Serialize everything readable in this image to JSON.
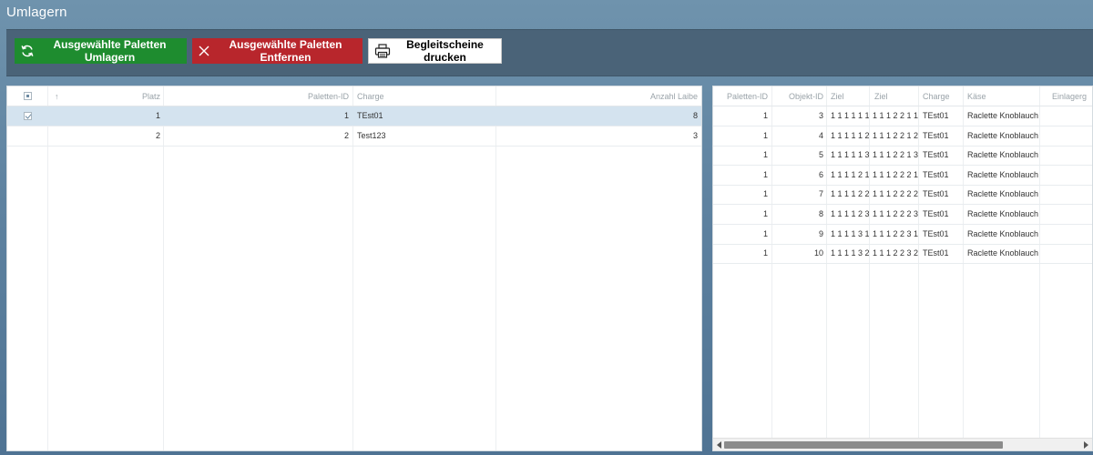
{
  "page": {
    "title": "Umlagern"
  },
  "toolbar": {
    "relocate_label": "Ausgewählte Paletten Umlagern",
    "remove_label": "Ausgewählte Paletten Entfernen",
    "print_label": "Begleitscheine drucken"
  },
  "left_grid": {
    "columns": {
      "sort": "↑",
      "platz": "Platz",
      "paletten_id": "Paletten-ID",
      "charge": "Charge",
      "anzahl": "Anzahl Laibe"
    },
    "rows": [
      {
        "selected": true,
        "platz": "1",
        "paletten_id": "1",
        "charge": "TEst01",
        "anzahl": "8"
      },
      {
        "selected": false,
        "platz": "2",
        "paletten_id": "2",
        "charge": "Test123",
        "anzahl": "3"
      }
    ]
  },
  "right_grid": {
    "columns": {
      "paletten_id": "Paletten-ID",
      "objekt_id": "Objekt-ID",
      "ziel1": "Ziel",
      "ziel2": "Ziel",
      "charge": "Charge",
      "kaese": "Käse",
      "einlager": "Einlagerg"
    },
    "rows": [
      {
        "paletten_id": "1",
        "objekt_id": "3",
        "ziel1": "1 1 1 1 1 1",
        "ziel2": "1 1 1 2 2 1 1",
        "charge": "TEst01",
        "kaese": "Raclette Knoblauch"
      },
      {
        "paletten_id": "1",
        "objekt_id": "4",
        "ziel1": "1 1 1 1 1 2",
        "ziel2": "1 1 1 2 2 1 2",
        "charge": "TEst01",
        "kaese": "Raclette Knoblauch"
      },
      {
        "paletten_id": "1",
        "objekt_id": "5",
        "ziel1": "1 1 1 1 1 3",
        "ziel2": "1 1 1 2 2 1 3",
        "charge": "TEst01",
        "kaese": "Raclette Knoblauch"
      },
      {
        "paletten_id": "1",
        "objekt_id": "6",
        "ziel1": "1 1 1 1 2 1",
        "ziel2": "1 1 1 2 2 2 1",
        "charge": "TEst01",
        "kaese": "Raclette Knoblauch"
      },
      {
        "paletten_id": "1",
        "objekt_id": "7",
        "ziel1": "1 1 1 1 2 2",
        "ziel2": "1 1 1 2 2 2 2",
        "charge": "TEst01",
        "kaese": "Raclette Knoblauch"
      },
      {
        "paletten_id": "1",
        "objekt_id": "8",
        "ziel1": "1 1 1 1 2 3",
        "ziel2": "1 1 1 2 2 2 3",
        "charge": "TEst01",
        "kaese": "Raclette Knoblauch"
      },
      {
        "paletten_id": "1",
        "objekt_id": "9",
        "ziel1": "1 1 1 1 3 1",
        "ziel2": "1 1 1 2 2 3 1",
        "charge": "TEst01",
        "kaese": "Raclette Knoblauch"
      },
      {
        "paletten_id": "1",
        "objekt_id": "10",
        "ziel1": "1 1 1 1 3 2",
        "ziel2": "1 1 1 2 2 3 2",
        "charge": "TEst01",
        "kaese": "Raclette Knoblauch"
      }
    ]
  },
  "colors": {
    "relocate": "#1e8c2f",
    "remove": "#b8262c",
    "selected_row": "#d4e3ef"
  },
  "icons": {
    "relocate": "refresh-icon",
    "remove": "close-icon",
    "print": "printer-icon"
  }
}
